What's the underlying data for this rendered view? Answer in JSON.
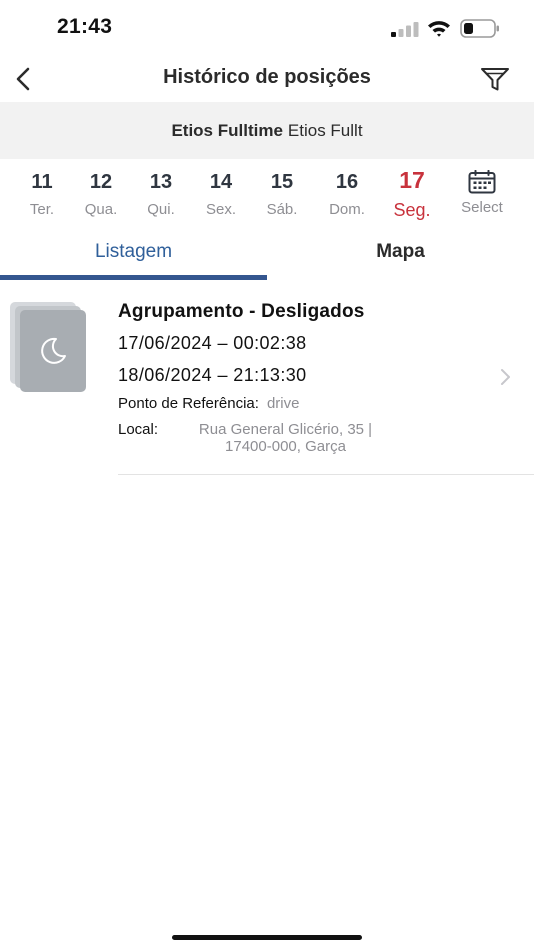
{
  "status_bar": {
    "time": "21:43"
  },
  "nav": {
    "title": "Histórico de posições"
  },
  "vehicle": {
    "name": "Etios Fulltime",
    "model": "Etios Fullt"
  },
  "days": [
    {
      "num": "11",
      "weekday": "Ter."
    },
    {
      "num": "12",
      "weekday": "Qua."
    },
    {
      "num": "13",
      "weekday": "Qui."
    },
    {
      "num": "14",
      "weekday": "Sex."
    },
    {
      "num": "15",
      "weekday": "Sáb."
    },
    {
      "num": "16",
      "weekday": "Dom."
    },
    {
      "num": "17",
      "weekday": "Seg."
    },
    {
      "num": "",
      "weekday": "Select"
    }
  ],
  "active_day_index": 6,
  "tabs": {
    "list": "Listagem",
    "map": "Mapa"
  },
  "item": {
    "title": "Agrupamento - Desligados",
    "start": "17/06/2024 – 00:02:38",
    "end": "18/06/2024 – 21:13:30",
    "reference_label": "Ponto de Referência:",
    "reference_value": "drive",
    "local_label": "Local:",
    "local_value": "Rua General Glicério, 35 |\n17400-000, Garça",
    "icon": "moon-icon"
  },
  "colors": {
    "accent_blue": "#34568f",
    "active_red": "#c8323c",
    "muted_gray": "#8e8e93",
    "vehicle_bar_bg": "#f2f2f2"
  }
}
